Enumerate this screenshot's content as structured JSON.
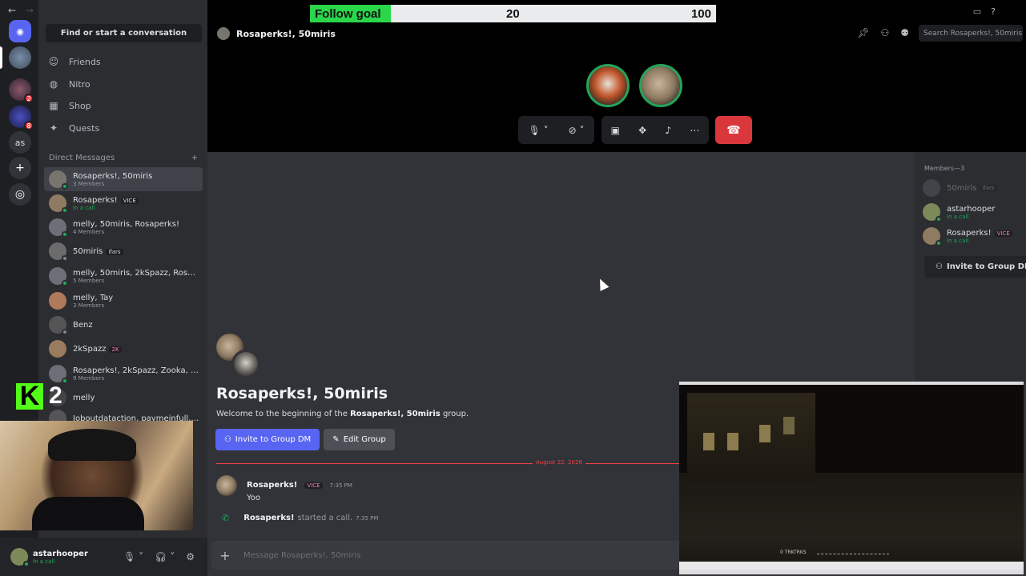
{
  "follow_goal": {
    "label": "Follow goal",
    "current": "20",
    "target": "100",
    "progress": 0.2,
    "color": "#2ad64a"
  },
  "window": {
    "back_icon": "arrow-left-icon",
    "forward_icon": "arrow-right-icon",
    "inbox_icon": "inbox-icon",
    "help_icon": "help-icon"
  },
  "servers": [
    {
      "name": "home",
      "icon": "discord-icon",
      "badge": ""
    },
    {
      "name": "server-1",
      "badge": ""
    },
    {
      "name": "server-2",
      "badge": "2"
    },
    {
      "name": "server-3",
      "badge": "8"
    },
    {
      "name": "as",
      "label": "as",
      "badge": ""
    },
    {
      "name": "add-server",
      "icon": "plus-icon",
      "badge": ""
    },
    {
      "name": "discover",
      "icon": "compass-icon",
      "badge": ""
    }
  ],
  "sidebar": {
    "search_label": "Find or start a conversation",
    "nav": [
      {
        "label": "Friends",
        "icon": "friends-icon"
      },
      {
        "label": "Nitro",
        "icon": "nitro-icon"
      },
      {
        "label": "Shop",
        "icon": "shop-icon"
      },
      {
        "label": "Quests",
        "icon": "quests-icon"
      }
    ],
    "dm_header": "Direct Messages",
    "dms": [
      {
        "name": "Rosaperks!, 50miris",
        "sub": "3 Members",
        "tag": "",
        "active": true
      },
      {
        "name": "Rosaperks!",
        "sub": "In a call",
        "tag": "VICE",
        "call": true
      },
      {
        "name": "melly, 50miris, Rosaperks!",
        "sub": "4 Members",
        "tag": ""
      },
      {
        "name": "50miris",
        "sub": "",
        "tag": "ifars"
      },
      {
        "name": "melly, 50miris, 2kSpazz, Rosaperks!",
        "sub": "5 Members",
        "tag": ""
      },
      {
        "name": "melly, Tay",
        "sub": "3 Members",
        "tag": ""
      },
      {
        "name": "Benz",
        "sub": "",
        "tag": ""
      },
      {
        "name": "2kSpazz",
        "sub": "",
        "tag": "2K"
      },
      {
        "name": "Rosaperks!, 2kSpazz, Zooka, Ko...",
        "sub": "9 Members",
        "tag": ""
      },
      {
        "name": "melly",
        "sub": "",
        "tag": ""
      },
      {
        "name": "Joboutdataction, paymeinfull, ...",
        "sub": "",
        "tag": ""
      }
    ]
  },
  "kick": {
    "logo": "K",
    "viewers": "2",
    "color": "#53fc18"
  },
  "user_panel": {
    "name": "astarhooper",
    "status": "In a call",
    "mic_icon": "mic-icon",
    "headset_icon": "headset-icon",
    "settings_icon": "gear-icon"
  },
  "call": {
    "title": "Rosaperks!, 50miris",
    "search_placeholder": "Search Rosaperks!, 50miris",
    "end_icon": "hangup-icon"
  },
  "chat": {
    "title": "Rosaperks!, 50miris",
    "welcome_pre": "Welcome to the beginning of the ",
    "welcome_bold": "Rosaperks!, 50miris",
    "welcome_post": " group.",
    "invite_label": "Invite to Group DM",
    "edit_label": "Edit Group",
    "date_divider": "August 22, 2026",
    "messages": [
      {
        "author": "Rosaperks!",
        "tag": "VICE",
        "time": "7:35 PM",
        "body": "Yoo"
      }
    ],
    "system": {
      "author": "Rosaperks!",
      "text": "started a call.",
      "time": "7:35 PM"
    },
    "composer_placeholder": "Message Rosaperks!, 50miris"
  },
  "members": {
    "header": "Members—3",
    "list": [
      {
        "name": "50miris",
        "tag": "ifars",
        "sub": "",
        "dim": true
      },
      {
        "name": "astarhooper",
        "tag": "",
        "sub": "In a call"
      },
      {
        "name": "Rosaperks!",
        "tag": "VICE",
        "sub": "In a call"
      }
    ],
    "invite_label": "Invite to Group DM"
  },
  "game": {
    "hud_label": "0 TRKTRKS"
  }
}
